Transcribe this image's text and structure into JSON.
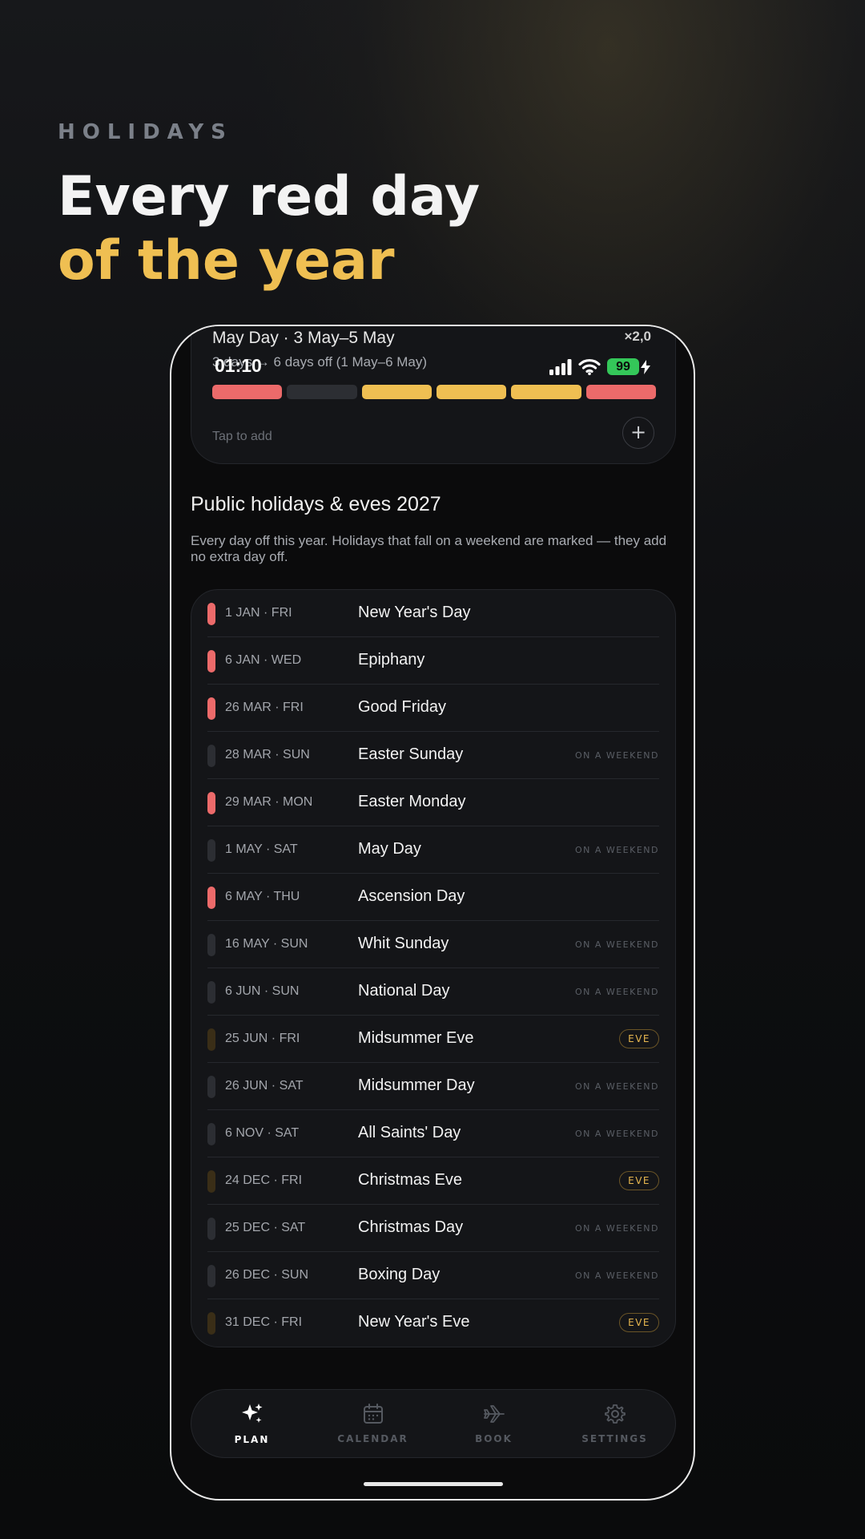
{
  "hero": {
    "eyebrow": "HOLIDAYS",
    "headline_line1": "Every red day",
    "headline_line2": "of the year",
    "accent_color": "#efbf52"
  },
  "status_bar": {
    "time": "01:10",
    "battery": "99"
  },
  "plan_card": {
    "title": "May Day · 3 May–5 May",
    "multiplier": "×2,0",
    "summary": "3 days → 6 days off (1 May–6 May)",
    "day_states": [
      "holiday",
      "weekday",
      "leave",
      "leave",
      "leave",
      "holiday"
    ],
    "add_hint": "Tap to add",
    "add_icon": "+"
  },
  "section": {
    "title": "Public holidays & eves 2027",
    "description": "Every day off this year. Holidays that fall on a weekend are marked — they add no extra day off."
  },
  "colors": {
    "holiday": "#ec6a6a",
    "weekend": "#2c2e33",
    "eve": "#3a2e17",
    "leave": "#efbf52",
    "weekday": "#2c2e33"
  },
  "holidays": [
    {
      "date": "1 JAN · FRI",
      "name": "New Year's Day",
      "kind": "holiday",
      "tag": ""
    },
    {
      "date": "6 JAN · WED",
      "name": "Epiphany",
      "kind": "holiday",
      "tag": ""
    },
    {
      "date": "26 MAR · FRI",
      "name": "Good Friday",
      "kind": "holiday",
      "tag": ""
    },
    {
      "date": "28 MAR · SUN",
      "name": "Easter Sunday",
      "kind": "weekend",
      "tag": "ON A WEEKEND"
    },
    {
      "date": "29 MAR · MON",
      "name": "Easter Monday",
      "kind": "holiday",
      "tag": ""
    },
    {
      "date": "1 MAY · SAT",
      "name": "May Day",
      "kind": "weekend",
      "tag": "ON A WEEKEND"
    },
    {
      "date": "6 MAY · THU",
      "name": "Ascension Day",
      "kind": "holiday",
      "tag": ""
    },
    {
      "date": "16 MAY · SUN",
      "name": "Whit Sunday",
      "kind": "weekend",
      "tag": "ON A WEEKEND"
    },
    {
      "date": "6 JUN · SUN",
      "name": "National Day",
      "kind": "weekend",
      "tag": "ON A WEEKEND"
    },
    {
      "date": "25 JUN · FRI",
      "name": "Midsummer Eve",
      "kind": "eve",
      "tag": "EVE"
    },
    {
      "date": "26 JUN · SAT",
      "name": "Midsummer Day",
      "kind": "weekend",
      "tag": "ON A WEEKEND"
    },
    {
      "date": "6 NOV · SAT",
      "name": "All Saints' Day",
      "kind": "weekend",
      "tag": "ON A WEEKEND"
    },
    {
      "date": "24 DEC · FRI",
      "name": "Christmas Eve",
      "kind": "eve",
      "tag": "EVE"
    },
    {
      "date": "25 DEC · SAT",
      "name": "Christmas Day",
      "kind": "weekend",
      "tag": "ON A WEEKEND"
    },
    {
      "date": "26 DEC · SUN",
      "name": "Boxing Day",
      "kind": "weekend",
      "tag": "ON A WEEKEND"
    },
    {
      "date": "31 DEC · FRI",
      "name": "New Year's Eve",
      "kind": "eve",
      "tag": "EVE"
    }
  ],
  "tabs": [
    {
      "label": "PLAN",
      "icon": "sparkles-icon",
      "active": true
    },
    {
      "label": "CALENDAR",
      "icon": "calendar-icon",
      "active": false
    },
    {
      "label": "BOOK",
      "icon": "airplane-icon",
      "active": false
    },
    {
      "label": "SETTINGS",
      "icon": "gear-icon",
      "active": false
    }
  ]
}
